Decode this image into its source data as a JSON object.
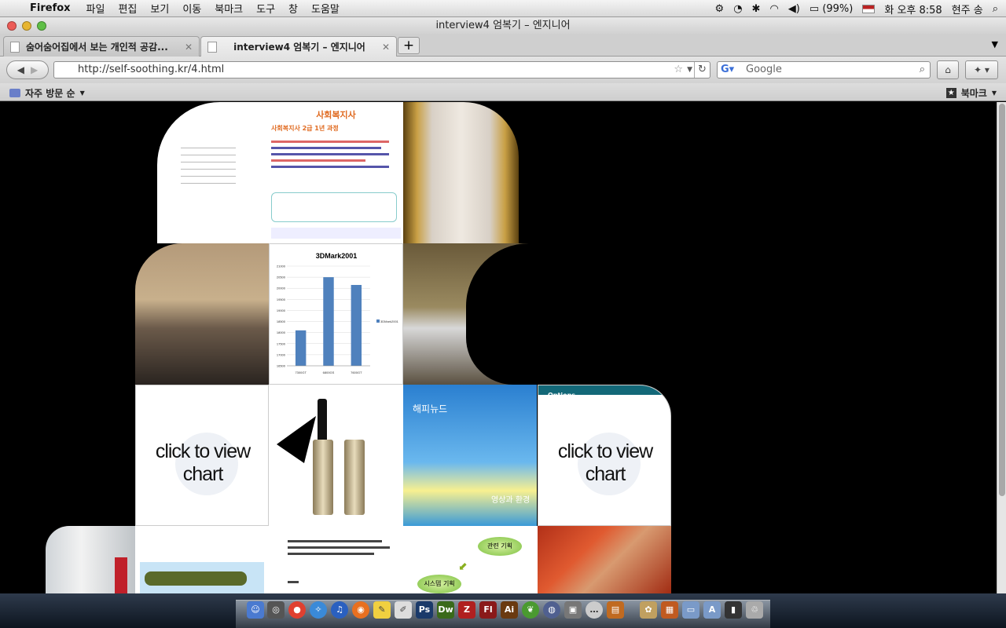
{
  "menubar": {
    "app": "Firefox",
    "items": [
      "파일",
      "편집",
      "보기",
      "이동",
      "북마크",
      "도구",
      "창",
      "도움말"
    ],
    "battery": "(99%)",
    "clock": "화 오후 8:58",
    "user": "현주 송"
  },
  "window": {
    "title": "interview4 엄복기 – 엔지니어"
  },
  "tabs": [
    {
      "label": "숨어숨어집에서 보는 개인적 공감..."
    },
    {
      "label": "interview4 엄복기 – 엔지니어"
    }
  ],
  "navbar": {
    "url": "http://self-soothing.kr/4.html",
    "search_placeholder": "Google"
  },
  "bookmarks": {
    "most_visited": "자주 방문 순",
    "bookmarks_menu": "북마크"
  },
  "page": {
    "poster_title": "사회복지사 2급 1년 과정",
    "poster_sub": "사회복지사",
    "chart_title": "3DMark2001",
    "chart_legend": "3DMark2001",
    "options": "Options",
    "click_to_view": "click to view chart",
    "sky_text": "해피뉴드",
    "sky_text2": "영상과 환경",
    "flow1": "관련 기획",
    "flow2": "시스템 기획"
  },
  "chart_data": {
    "type": "bar",
    "title": "3DMark2001",
    "categories": [
      "7300GT",
      "6800GS",
      "7600GT"
    ],
    "series": [
      {
        "name": "3DMark2001",
        "values": [
          18100,
          20500,
          20150
        ]
      }
    ],
    "ylim": [
      16500,
      21000
    ],
    "yticks": [
      16500,
      17000,
      17500,
      18000,
      18500,
      19000,
      19500,
      20000,
      20500,
      21000
    ],
    "legend": "right",
    "colors": [
      "#4f81bd"
    ]
  }
}
